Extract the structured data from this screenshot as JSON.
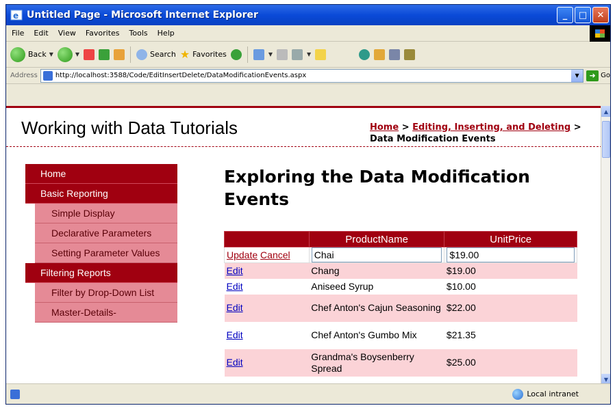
{
  "window": {
    "title": "Untitled Page - Microsoft Internet Explorer",
    "buttons": {
      "minimize": "_",
      "maximize": "□",
      "close": "✕"
    }
  },
  "menu": [
    {
      "label": "File",
      "accel": "F"
    },
    {
      "label": "Edit",
      "accel": "E"
    },
    {
      "label": "View",
      "accel": "V"
    },
    {
      "label": "Favorites",
      "accel": "a"
    },
    {
      "label": "Tools",
      "accel": "T"
    },
    {
      "label": "Help",
      "accel": "H"
    }
  ],
  "toolbar": {
    "back_label": "Back",
    "search_label": "Search",
    "favorites_label": "Favorites"
  },
  "address": {
    "label": "Address",
    "url": "http://localhost:3588/Code/EditInsertDelete/DataModificationEvents.aspx",
    "go_label": "Go"
  },
  "site": {
    "title": "Working with Data Tutorials",
    "breadcrumb": {
      "home": "Home",
      "sep1": " > ",
      "section": "Editing, Inserting, and Deleting",
      "sep2": " > ",
      "current": "Data Modification Events"
    }
  },
  "sidebar": {
    "home": "Home",
    "basic_reporting": "Basic Reporting",
    "simple_display": "Simple Display",
    "declarative_parameters": "Declarative Parameters",
    "setting_parameter_values": "Setting Parameter Values",
    "filtering_reports": "Filtering Reports",
    "filter_by_dropdown": "Filter by Drop-Down List",
    "master_details": "Master-Details-"
  },
  "page": {
    "title": "Exploring the Data Modification Events"
  },
  "grid": {
    "headers": {
      "command": "",
      "product": "ProductName",
      "price": "UnitPrice"
    },
    "edit_row": {
      "update": "Update",
      "cancel": "Cancel",
      "product": "Chai",
      "price": "$19.00"
    },
    "edit_label": "Edit",
    "rows": [
      {
        "product": "Chang",
        "price": "$19.00"
      },
      {
        "product": "Aniseed Syrup",
        "price": "$10.00"
      },
      {
        "product": "Chef Anton's Cajun Seasoning",
        "price": "$22.00"
      },
      {
        "product": "Chef Anton's Gumbo Mix",
        "price": "$21.35"
      },
      {
        "product": "Grandma's Boysenberry Spread",
        "price": "$25.00"
      }
    ]
  },
  "status": {
    "zone": "Local intranet"
  }
}
